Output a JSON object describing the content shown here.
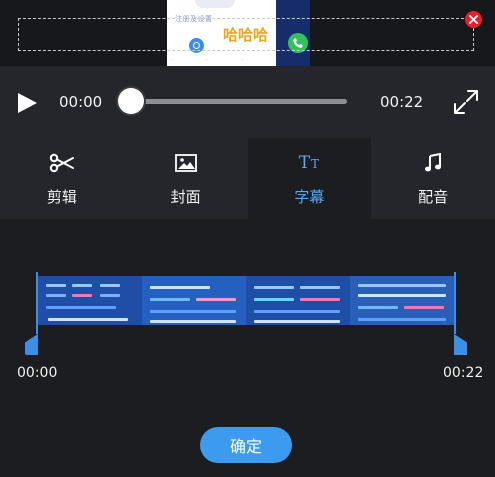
{
  "preview": {
    "phone_top_text": "注册及设置",
    "phone_caption": "哈哈哈",
    "phone_tick_labels": "· · ·"
  },
  "player": {
    "current_time": "00:00",
    "total_time": "00:22",
    "progress": 0.0
  },
  "tabs": [
    {
      "label": "剪辑",
      "icon": "scissors-icon"
    },
    {
      "label": "封面",
      "icon": "image-icon"
    },
    {
      "label": "字幕",
      "icon": "text-size-icon"
    },
    {
      "label": "配音",
      "icon": "music-note-icon"
    }
  ],
  "active_tab": "字幕",
  "timeline": {
    "start_time": "00:00",
    "end_time": "00:22"
  },
  "confirm_label": "确定",
  "colors": {
    "accent": "#3d9bef",
    "close": "#e8202d",
    "background": "#1c1d21",
    "panel": "#25262b"
  }
}
